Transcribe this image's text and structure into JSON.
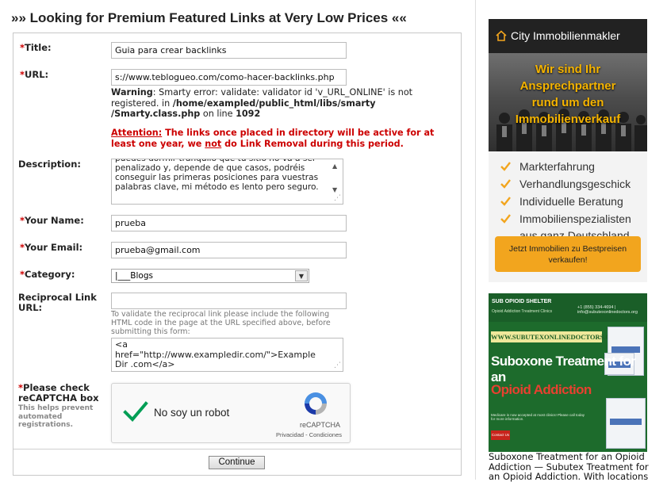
{
  "page": {
    "heading": "»» Looking for Premium Featured Links at Very Low Prices ««"
  },
  "form": {
    "required_mark": "*",
    "title_label": "Title:",
    "title_value": "Guia para crear backlinks",
    "url_label": "URL:",
    "url_value": "s://www.teblogueo.com/como-hacer-backlinks.php",
    "warning_label": "Warning",
    "warning_text": ": Smarty error: validate: validator id 'v_URL_ONLINE' is not registered. in ",
    "warning_path": "/home/exampled/public_html/libs/smarty /Smarty.class.php",
    "warning_online": " on line ",
    "warning_line": "1092",
    "attention_label": "Attention:",
    "attention_text1": " The links once placed in directory will be active for at least one year, we ",
    "attention_not": "not",
    "attention_text2": " do Link Removal during this period.",
    "description_label": "Description:",
    "description_value": "puedes dormir tranquilo que tu sitio no va a ser penalizado y, depende de que casos, podréis conseguir las primeras posiciones para vuestras palabras clave, mi método es lento pero seguro.",
    "name_label": "Your Name:",
    "name_value": "prueba",
    "email_label": "Your Email:",
    "email_value": "prueba@gmail.com",
    "category_label": "Category:",
    "category_value": "|___Blogs",
    "reciprocal_label": "Reciprocal Link URL:",
    "reciprocal_value": "",
    "reciprocal_hint": "To validate the reciprocal link please include the following HTML code in the page at the URL specified above, before submitting this form:",
    "reciprocal_code": "<a href=\"http://www.exampledir.com/\">Example Dir .com</a>",
    "captcha_label": "Please check reCAPTCHA box",
    "captcha_note": "This helps prevent automated registrations.",
    "submit_label": "Continue"
  },
  "recaptcha": {
    "checkbox_text": "No soy un robot",
    "brand": "reCAPTCHA",
    "links": "Privacidad - Condiciones"
  },
  "ad1": {
    "company": "City Immobilienmakler",
    "slogan_lines": [
      "Wir sind Ihr",
      "Ansprechpartner",
      "rund um den",
      "Immobilienverkauf"
    ],
    "features": [
      "Markterfahrung",
      "Verhandlungsgeschick",
      "Individuelle Beratung",
      "Immobilienspezialisten aus ganz Deutschland"
    ],
    "cta": "Jetzt Immobilien zu Bestpreisen verkaufen!",
    "accent_color": "#f2a51e"
  },
  "ad2": {
    "logo_title": "SUB OPIOID SHELTER",
    "logo_sub": "Opioid Addiction Treatment Clinics",
    "phone": "+1 (855) 334-4694  |  info@subutexonlinedoctors.org",
    "url": "WWW.SUBUTEXONLINEDOCTORS.ORG",
    "headline1": "Suboxone Treatment for an",
    "headline2": "Opioid Addiction",
    "fineprint": "Medicare is now accepted at most clinics! Please call today for more information.",
    "contact": "Contact Us",
    "caption": "Suboxone Treatment for an Opioid Addiction — Subutex Treatment for an Opioid Addiction. With locations"
  },
  "icons": {
    "checkmark": "check-icon",
    "house": "house-icon",
    "recaptcha": "recaptcha-logo-icon"
  },
  "colors": {
    "required": "#cc0000",
    "attention": "#cc0000",
    "recaptcha_check": "#009e55"
  }
}
